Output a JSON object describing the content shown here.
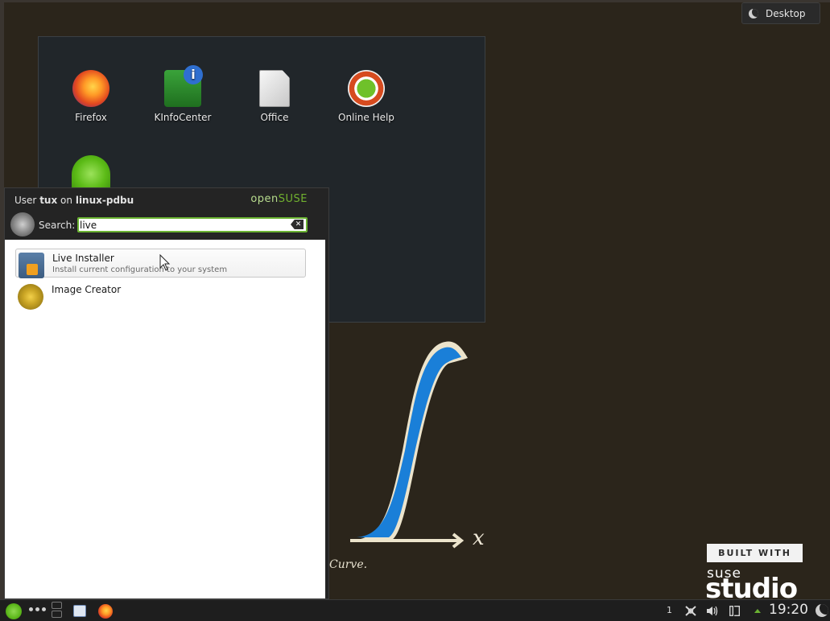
{
  "desktop_toolbox": {
    "label": "Desktop"
  },
  "folder_view": {
    "icons": [
      {
        "label": "Firefox"
      },
      {
        "label": "KInfoCenter"
      },
      {
        "label": "Office"
      },
      {
        "label": "Online Help"
      }
    ]
  },
  "launcher": {
    "user_prefix": "User",
    "user_name": "tux",
    "on_word": "on",
    "host_name": "linux-pdbu",
    "brand_open": "open",
    "brand_suse": "SUSE",
    "search_label": "Search:",
    "search_value": "live",
    "results": [
      {
        "title": "Live Installer",
        "subtitle": "Install current configuration to your system",
        "icon": "installer-icon"
      },
      {
        "title": "Image Creator",
        "subtitle": "",
        "icon": "image-creator-icon"
      }
    ]
  },
  "wallpaper": {
    "built_with": "BUILT WITH",
    "suse": "suse",
    "studio": "studio",
    "caption": "Curve.",
    "x_label": "x"
  },
  "panel": {
    "virtual_desktop_number": "1",
    "clock": "19:20"
  },
  "colors": {
    "accent_green": "#6ab232",
    "wallpaper_brown": "#2b251b",
    "curve_blue": "#1a7fd8"
  }
}
